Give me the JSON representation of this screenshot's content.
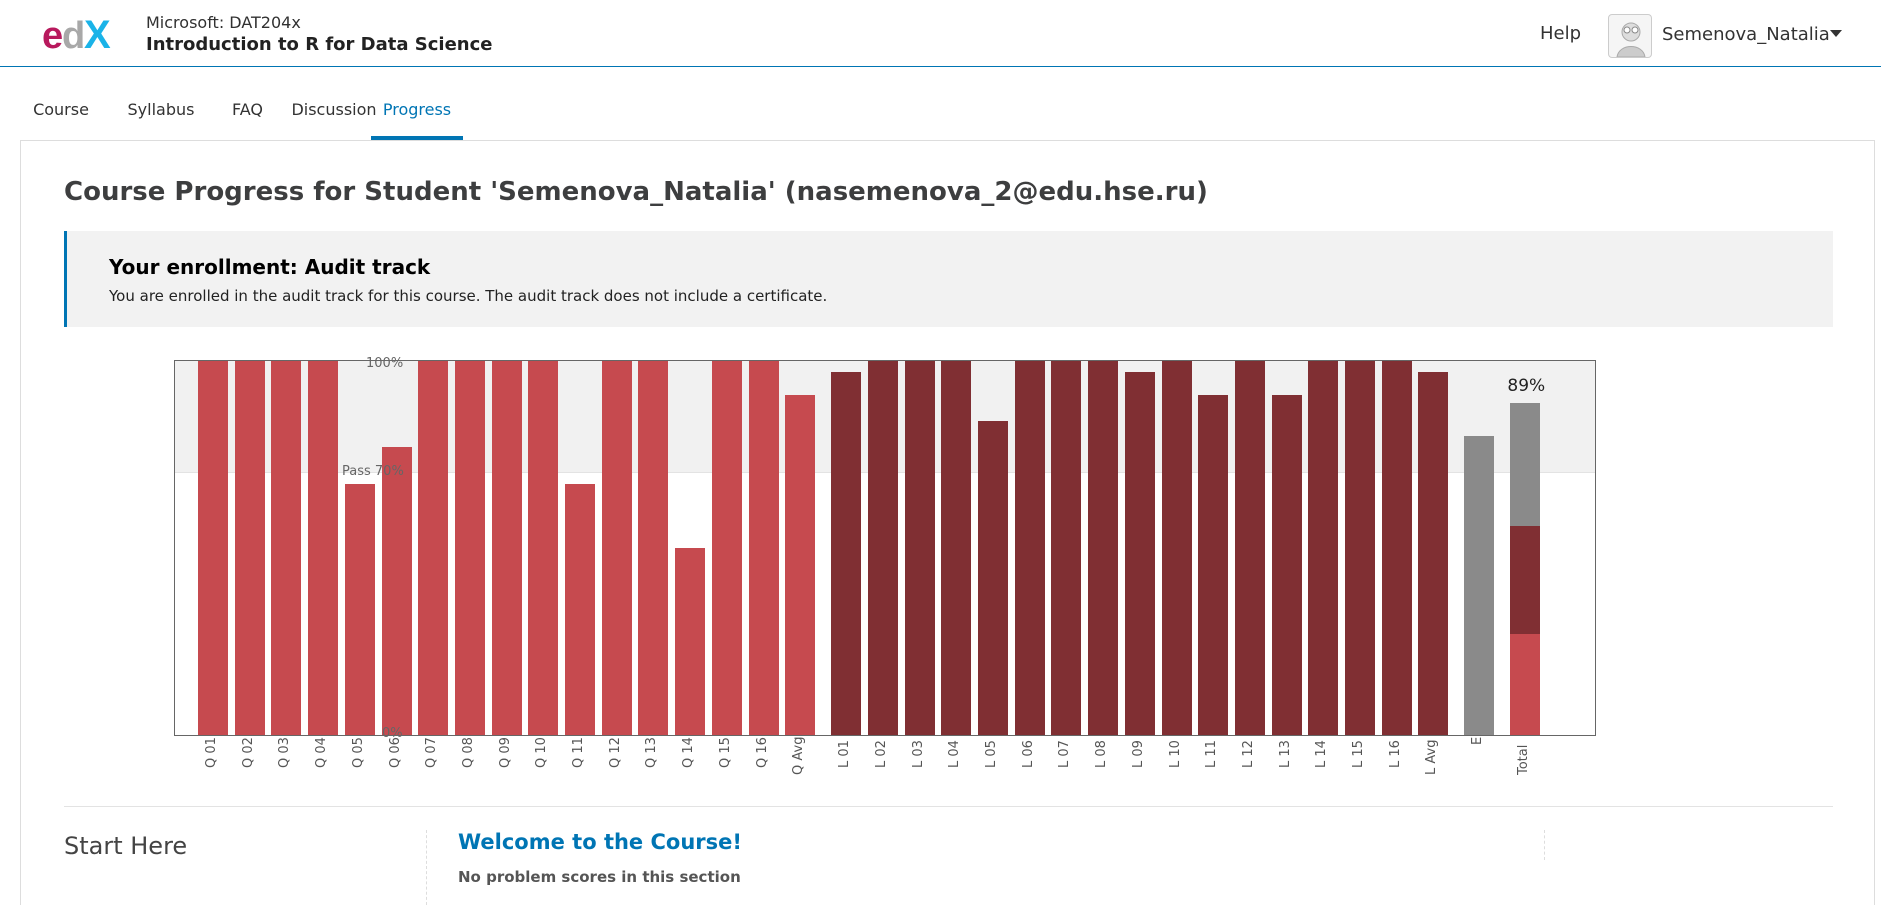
{
  "header": {
    "logo_text": "edX",
    "course_org": "Microsoft: DAT204x",
    "course_name": "Introduction to R for Data Science",
    "help_label": "Help",
    "username": "Semenova_Natalia"
  },
  "tabs": [
    {
      "label": "Course",
      "active": false
    },
    {
      "label": "Syllabus",
      "active": false
    },
    {
      "label": "FAQ",
      "active": false
    },
    {
      "label": "Discussion",
      "active": false
    },
    {
      "label": "Progress",
      "active": true
    }
  ],
  "main": {
    "title": "Course Progress for Student 'Semenova_Natalia' (nasemenova_2@edu.hse.ru)",
    "enrollment": {
      "title": "Your enrollment: Audit track",
      "message": "You are enrolled in the audit track for this course. The audit track does not include a certificate."
    }
  },
  "chart_data": {
    "type": "bar",
    "ylim": [
      0,
      100
    ],
    "y_tick_labels": [
      "100%",
      "0%"
    ],
    "pass_line": {
      "value": 70,
      "label": "Pass 70%"
    },
    "colors": {
      "quiz": "#c64a4f",
      "lab": "#802f33",
      "exam": "#8a8a8a"
    },
    "categories": [
      "Q 01",
      "Q 02",
      "Q 03",
      "Q 04",
      "Q 05",
      "Q 06",
      "Q 07",
      "Q 08",
      "Q 09",
      "Q 10",
      "Q 11",
      "Q 12",
      "Q 13",
      "Q 14",
      "Q 15",
      "Q 16",
      "Q Avg",
      "L 01",
      "L 02",
      "L 03",
      "L 04",
      "L 05",
      "L 06",
      "L 07",
      "L 08",
      "L 09",
      "L 10",
      "L 11",
      "L 12",
      "L 13",
      "L 14",
      "L 15",
      "L 16",
      "L Avg",
      "E",
      "Total"
    ],
    "values": [
      100,
      100,
      100,
      100,
      67,
      77,
      100,
      100,
      100,
      100,
      67,
      100,
      100,
      50,
      100,
      100,
      91,
      97,
      100,
      100,
      100,
      84,
      100,
      100,
      100,
      97,
      100,
      91,
      100,
      91,
      100,
      100,
      100,
      97,
      80,
      89
    ],
    "groups": [
      "quiz",
      "quiz",
      "quiz",
      "quiz",
      "quiz",
      "quiz",
      "quiz",
      "quiz",
      "quiz",
      "quiz",
      "quiz",
      "quiz",
      "quiz",
      "quiz",
      "quiz",
      "quiz",
      "quiz",
      "lab",
      "lab",
      "lab",
      "lab",
      "lab",
      "lab",
      "lab",
      "lab",
      "lab",
      "lab",
      "lab",
      "lab",
      "lab",
      "lab",
      "lab",
      "lab",
      "lab",
      "exam",
      "total"
    ],
    "total": {
      "label": "89%",
      "segments": [
        {
          "group": "quiz",
          "value": 27
        },
        {
          "group": "lab",
          "value": 29
        },
        {
          "group": "exam",
          "value": 33
        }
      ]
    }
  },
  "section": {
    "name": "Start Here",
    "subsection_title": "Welcome to the Course!",
    "scores_note": "No problem scores in this section"
  }
}
